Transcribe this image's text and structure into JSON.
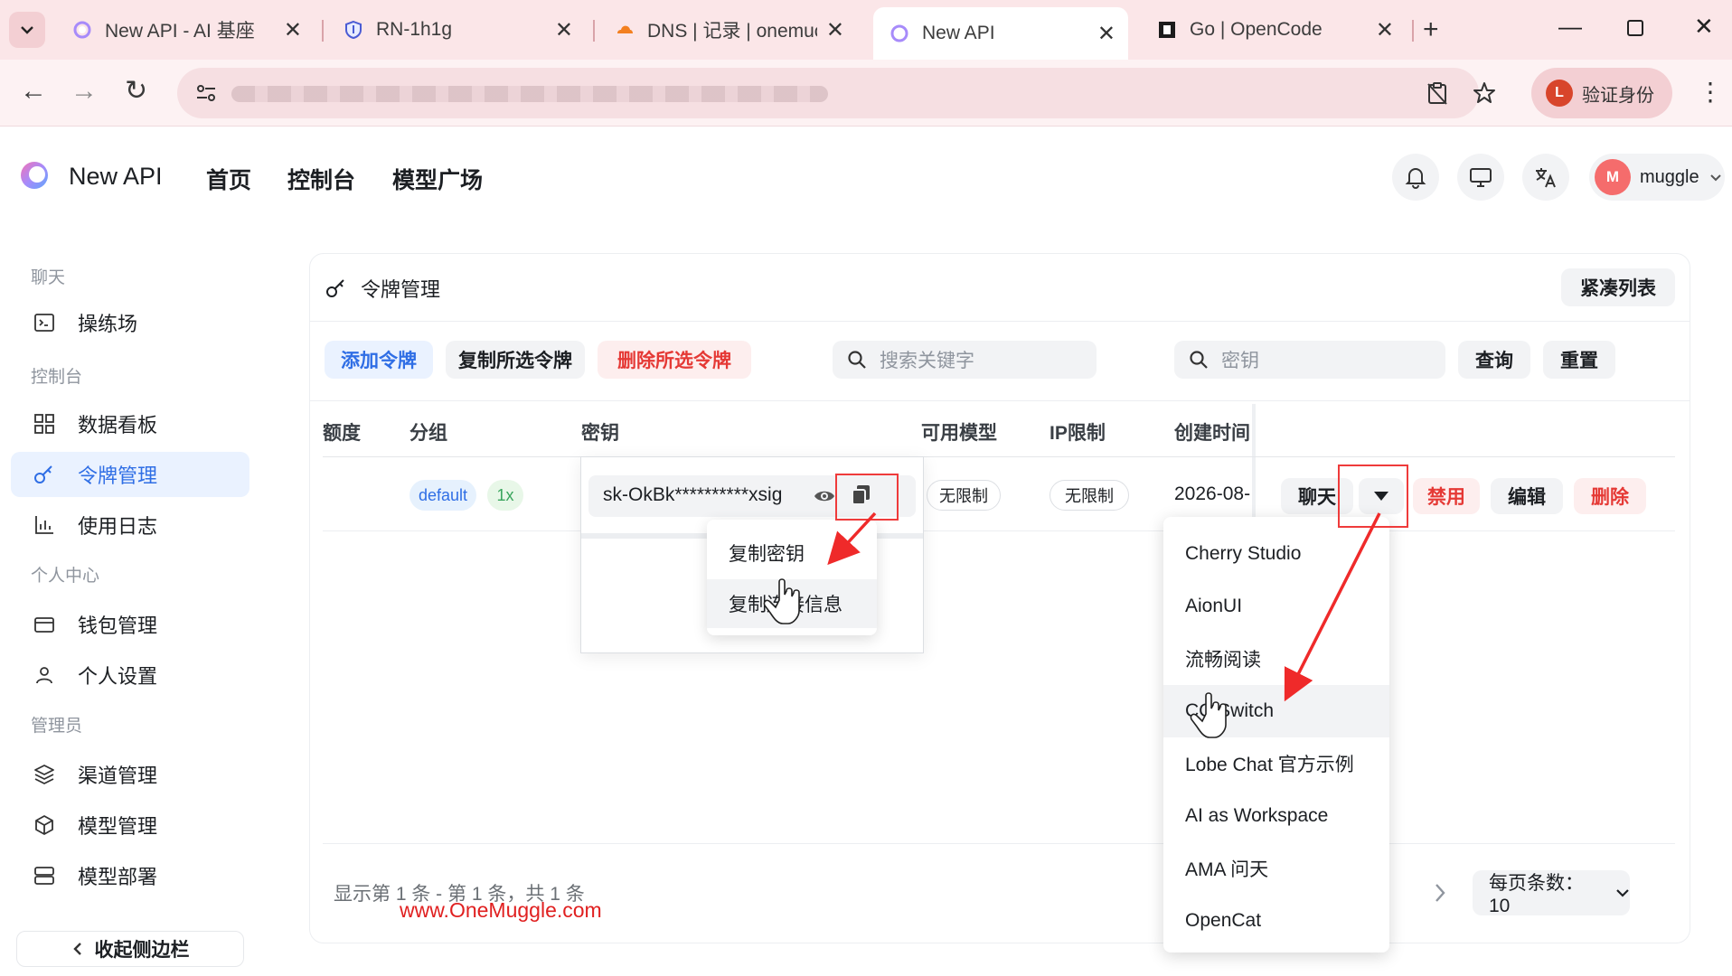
{
  "browser": {
    "tabs": [
      {
        "title": "New API - AI 基座",
        "icon": "newapi-logo-icon"
      },
      {
        "title": "RN-1h1g",
        "icon": "shield-icon"
      },
      {
        "title": "DNS | 记录 | onemuc",
        "icon": "cloudflare-icon"
      },
      {
        "title": "New API",
        "icon": "newapi-logo-icon",
        "active": true
      },
      {
        "title": "Go | OpenCode",
        "icon": "opencode-icon"
      }
    ],
    "verify_label": "验证身份",
    "verify_avatar": "L",
    "accent": "#fbe6e8"
  },
  "header": {
    "app_name": "New API",
    "nav": [
      "首页",
      "控制台",
      "模型广场"
    ],
    "user": {
      "initial": "M",
      "name": "muggle"
    }
  },
  "sidebar": {
    "sections": [
      {
        "title": "聊天",
        "items": [
          "操练场"
        ]
      },
      {
        "title": "控制台",
        "items": [
          "数据看板",
          "令牌管理",
          "使用日志"
        ]
      },
      {
        "title": "个人中心",
        "items": [
          "钱包管理",
          "个人设置"
        ]
      },
      {
        "title": "管理员",
        "items": [
          "渠道管理",
          "模型管理",
          "模型部署"
        ]
      }
    ],
    "active_item": "令牌管理",
    "collapse_label": "收起侧边栏"
  },
  "main": {
    "title": "令牌管理",
    "compact_label": "紧凑列表",
    "actions": {
      "add": "添加令牌",
      "copy_selected": "复制所选令牌",
      "delete_selected": "删除所选令牌"
    },
    "search_keyword_placeholder": "搜索关键字",
    "search_key_placeholder": "密钥",
    "query_label": "查询",
    "reset_label": "重置",
    "columns": [
      "额度",
      "分组",
      "密钥",
      "可用模型",
      "IP限制",
      "创建时间"
    ],
    "row": {
      "group": "default",
      "ratio": "1x",
      "key": "sk-OkBk**********xsig",
      "models": "无限制",
      "ip": "无限制",
      "created": "2026-08-",
      "chat": "聊天",
      "disable": "禁用",
      "edit": "编辑",
      "delete": "删除"
    },
    "pager_text": "显示第 1 条 - 第 1 条，共 1 条",
    "per_page": "每页条数：10"
  },
  "copy_menu": [
    "复制密钥",
    "复制连接信息"
  ],
  "chat_menu": [
    "Cherry Studio",
    "AionUI",
    "流畅阅读",
    "CC Switch",
    "Lobe Chat 官方示例",
    "AI as Workspace",
    "AMA 问天",
    "OpenCat"
  ],
  "watermark": "www.OneMuggle.com",
  "colors": {
    "primary": "#2f6ee5",
    "danger": "#e53935",
    "annotation": "#ef3b3b"
  }
}
